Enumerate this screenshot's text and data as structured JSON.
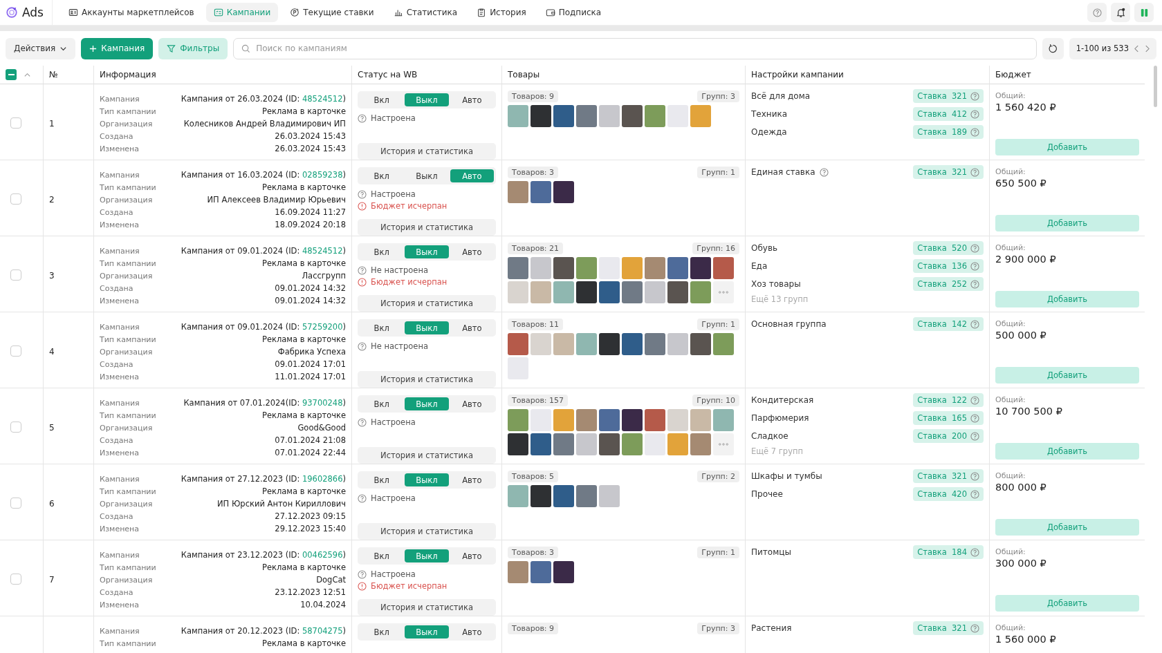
{
  "app": {
    "name": "Ads"
  },
  "nav": [
    {
      "label": "Аккаунты маркетплейсов",
      "selected": false
    },
    {
      "label": "Кампании",
      "selected": true
    },
    {
      "label": "Текущие ставки",
      "selected": false
    },
    {
      "label": "Статистика",
      "selected": false
    },
    {
      "label": "История",
      "selected": false
    },
    {
      "label": "Подписка",
      "selected": false
    }
  ],
  "select_all": {
    "checked": true
  },
  "toolbar": {
    "actions": "Действия",
    "add": "Кампания",
    "filters": "Фильтры",
    "search_placeholder": "Поиск по кампаниям",
    "pagination": "1-100 из 533"
  },
  "columns": [
    "№",
    "Информация",
    "Статус на WB",
    "Товары",
    "Настройки кампании",
    "Бюджет"
  ],
  "rows": [
    {
      "number": "1",
      "selected": false,
      "info": [
        {
          "label": "Кампания",
          "value": "Кампания от 26.03.2024 (ID: ",
          "id": "48524512",
          "value_end": ")"
        },
        {
          "label": "Тип кампании",
          "value": "Реклама в карточке"
        },
        {
          "label": "Организация",
          "value": "Колесников Андрей Владимирович ИП"
        },
        {
          "label": "Создана",
          "value": "26.03.2024 15:43"
        },
        {
          "label": "Изменена",
          "value": "26.03.2024 15:43"
        }
      ],
      "modes": [
        {
          "label": "Вкл",
          "selected": false
        },
        {
          "label": "Выкл",
          "selected": true
        },
        {
          "label": "Авто",
          "selected": false
        }
      ],
      "status": [
        {
          "kind": "info",
          "text": "Настроена"
        }
      ],
      "history": "История и статистика",
      "products": "Товаров: 9",
      "groups_count": "Групп: 3",
      "more": false,
      "settings": [
        {
          "name": "Всё для дома",
          "bid": "Ставка  321"
        },
        {
          "name": "Техника",
          "bid": "Ставка  412"
        },
        {
          "name": "Одежда",
          "bid": "Ставка  189"
        }
      ],
      "budget": {
        "label": "Общий:",
        "amount": "1 560 420 ₽",
        "button": "Добавить"
      }
    },
    {
      "number": "2",
      "selected": false,
      "info": [
        {
          "label": "Кампания",
          "value": "Кампания от 16.03.2024 (ID: ",
          "id": "02859238",
          "value_end": ")"
        },
        {
          "label": "Тип кампании",
          "value": "Реклама в карточке"
        },
        {
          "label": "Организация",
          "value": "ИП Алексеев Владимир Юрьевич"
        },
        {
          "label": "Создана",
          "value": "16.09.2024 11:27"
        },
        {
          "label": "Изменена",
          "value": "18.09.2024 20:18"
        }
      ],
      "modes": [
        {
          "label": "Вкл",
          "selected": false
        },
        {
          "label": "Выкл",
          "selected": false
        },
        {
          "label": "Авто",
          "selected": true
        }
      ],
      "status": [
        {
          "kind": "info",
          "text": "Настроена"
        },
        {
          "kind": "error",
          "text": "Бюджет исчерпан"
        }
      ],
      "history": "История и статистика",
      "products": "Товаров: 3",
      "groups_count": "Групп: 1",
      "more": false,
      "settings": [
        {
          "name": "Единая ставка",
          "help": true,
          "bid": "Ставка  321"
        }
      ],
      "budget": {
        "label": "Общий:",
        "amount": "650 500 ₽",
        "button": "Добавить"
      }
    },
    {
      "number": "3",
      "selected": false,
      "info": [
        {
          "label": "Кампания",
          "value": "Кампания от 09.01.2024 (ID: ",
          "id": "48524512",
          "value_end": ")"
        },
        {
          "label": "Тип кампании",
          "value": "Реклама в карточке"
        },
        {
          "label": "Организация",
          "value": "Лассгрупп"
        },
        {
          "label": "Создана",
          "value": "09.01.2024 14:32"
        },
        {
          "label": "Изменена",
          "value": "09.01.2024 14:32"
        }
      ],
      "modes": [
        {
          "label": "Вкл",
          "selected": false
        },
        {
          "label": "Выкл",
          "selected": true
        },
        {
          "label": "Авто",
          "selected": false
        }
      ],
      "status": [
        {
          "kind": "info",
          "text": "Не настроена"
        },
        {
          "kind": "error",
          "text": "Бюджет исчерпан"
        }
      ],
      "history": "История и статистика",
      "products": "Товаров: 21",
      "groups_count": "Групп: 16",
      "more": true,
      "settings": [
        {
          "name": "Обувь",
          "bid": "Ставка  520"
        },
        {
          "name": "Еда",
          "bid": "Ставка  136"
        },
        {
          "name": "Хоз товары",
          "bid": "Ставка  252"
        }
      ],
      "more_groups": "Ещё 13 групп",
      "budget": {
        "label": "Общий:",
        "amount": "2 900 000 ₽",
        "button": "Добавить"
      }
    },
    {
      "number": "4",
      "selected": false,
      "info": [
        {
          "label": "Кампания",
          "value": "Кампания от 09.01.2024 (ID: ",
          "id": "57259200",
          "value_end": ")"
        },
        {
          "label": "Тип кампании",
          "value": "Реклама в карточке"
        },
        {
          "label": "Организация",
          "value": "Фабрика Успеха"
        },
        {
          "label": "Создана",
          "value": "09.01.2024 17:01"
        },
        {
          "label": "Изменена",
          "value": "11.01.2024 17:01"
        }
      ],
      "modes": [
        {
          "label": "Вкл",
          "selected": false
        },
        {
          "label": "Выкл",
          "selected": true
        },
        {
          "label": "Авто",
          "selected": false
        }
      ],
      "status": [
        {
          "kind": "info",
          "text": "Не настроена"
        }
      ],
      "history": "История и статистика",
      "products": "Товаров: 11",
      "groups_count": "Групп: 1",
      "more": false,
      "settings": [
        {
          "name": "Основная группа",
          "bid": "Ставка  142"
        }
      ],
      "budget": {
        "label": "Общий:",
        "amount": "500 000 ₽",
        "button": "Добавить"
      }
    },
    {
      "number": "5",
      "selected": false,
      "info": [
        {
          "label": "Кампания",
          "value": "Кампания от 07.01.2024(ID: ",
          "id": "93700248",
          "value_end": ")"
        },
        {
          "label": "Тип кампании",
          "value": "Реклама в карточке"
        },
        {
          "label": "Организация",
          "value": "Good&Good"
        },
        {
          "label": "Создана",
          "value": "07.01.2024 21:08"
        },
        {
          "label": "Изменена",
          "value": "07.01.2024 22:44"
        }
      ],
      "modes": [
        {
          "label": "Вкл",
          "selected": false
        },
        {
          "label": "Выкл",
          "selected": true
        },
        {
          "label": "Авто",
          "selected": false
        }
      ],
      "status": [
        {
          "kind": "info",
          "text": "Настроена"
        }
      ],
      "history": "История и статистика",
      "products": "Товаров: 157",
      "groups_count": "Групп: 10",
      "more": true,
      "settings": [
        {
          "name": "Кондитерская",
          "bid": "Ставка  122"
        },
        {
          "name": "Парфюмерия",
          "bid": "Ставка  165"
        },
        {
          "name": "Сладкое",
          "bid": "Ставка  200"
        }
      ],
      "more_groups": "Ещё 7 групп",
      "budget": {
        "label": "Общий:",
        "amount": "10 700 500 ₽",
        "button": "Добавить"
      }
    },
    {
      "number": "6",
      "selected": false,
      "info": [
        {
          "label": "Кампания",
          "value": "Кампания от 27.12.2023 (ID: ",
          "id": "19602866",
          "value_end": ")"
        },
        {
          "label": "Тип кампании",
          "value": "Реклама в карточке"
        },
        {
          "label": "Организация",
          "value": "ИП Юрский Антон Кириллович"
        },
        {
          "label": "Создана",
          "value": "27.12.2023 09:15"
        },
        {
          "label": "Изменена",
          "value": "29.12.2023 15:40"
        }
      ],
      "modes": [
        {
          "label": "Вкл",
          "selected": false
        },
        {
          "label": "Выкл",
          "selected": true
        },
        {
          "label": "Авто",
          "selected": false
        }
      ],
      "status": [
        {
          "kind": "info",
          "text": "Настроена"
        }
      ],
      "history": "История и статистика",
      "products": "Товаров: 5",
      "groups_count": "Групп: 2",
      "more": false,
      "settings": [
        {
          "name": "Шкафы и тумбы",
          "bid": "Ставка  321"
        },
        {
          "name": "Прочее",
          "bid": "Ставка  420"
        }
      ],
      "budget": {
        "label": "Общий:",
        "amount": "800 000 ₽",
        "button": "Добавить"
      }
    },
    {
      "number": "7",
      "selected": false,
      "info": [
        {
          "label": "Кампания",
          "value": "Кампания от 23.12.2023 (ID: ",
          "id": "00462596",
          "value_end": ")"
        },
        {
          "label": "Тип кампании",
          "value": "Реклама в карточке"
        },
        {
          "label": "Организация",
          "value": "DogCat"
        },
        {
          "label": "Создана",
          "value": "23.12.2023 12:51"
        },
        {
          "label": "Изменена",
          "value": "10.04.2024"
        }
      ],
      "modes": [
        {
          "label": "Вкл",
          "selected": false
        },
        {
          "label": "Выкл",
          "selected": true
        },
        {
          "label": "Авто",
          "selected": false
        }
      ],
      "status": [
        {
          "kind": "info",
          "text": "Настроена"
        },
        {
          "kind": "error",
          "text": "Бюджет исчерпан"
        }
      ],
      "history": "История и статистика",
      "products": "Товаров: 3",
      "groups_count": "Групп: 1",
      "more": false,
      "settings": [
        {
          "name": "Питомцы",
          "bid": "Ставка  184"
        }
      ],
      "budget": {
        "label": "Общий:",
        "amount": "300 000 ₽",
        "button": "Добавить"
      }
    },
    {
      "info": [
        {
          "label": "Кампания",
          "value": "Кампания от 20.12.2023 (ID: ",
          "id": "58704275",
          "value_end": ")"
        },
        {
          "label": "Тип кампании",
          "value": "Реклама в карточке"
        }
      ],
      "modes": [
        {
          "label": "Вкл",
          "selected": false
        },
        {
          "label": "Выкл",
          "selected": true
        },
        {
          "label": "Авто",
          "selected": false
        }
      ],
      "products": "Товаров: 9",
      "groups_count": "Групп: 3",
      "settings": [
        {
          "name": "Растения",
          "bid": "Ставка  321"
        }
      ],
      "budget": {
        "label": "Общий:",
        "amount": "1 560 000 ₽"
      }
    }
  ]
}
